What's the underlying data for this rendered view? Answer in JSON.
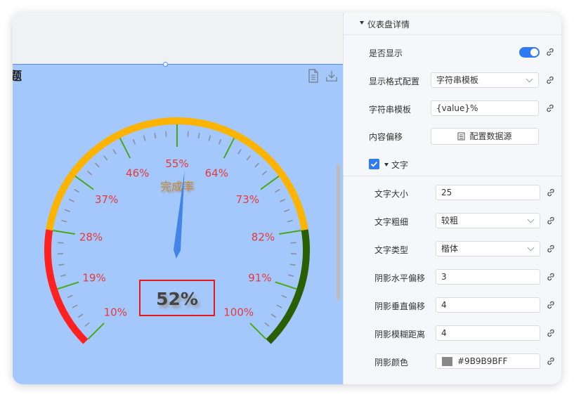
{
  "canvas": {
    "title_fragment": "题",
    "icons": [
      "document-icon",
      "download-icon"
    ]
  },
  "chart_data": {
    "type": "gauge",
    "value": 52,
    "min": 0,
    "max": 100,
    "detail_text": "52%",
    "title_text": "完成率",
    "tick_labels": [
      "10%",
      "19%",
      "28%",
      "37%",
      "46%",
      "55%",
      "64%",
      "73%",
      "82%",
      "91%",
      "100%"
    ],
    "color_bands": [
      {
        "to": 0.2,
        "color": "#ff2020"
      },
      {
        "to": 0.8,
        "color": "#fcb400"
      },
      {
        "to": 1.0,
        "color": "#2b5e00"
      }
    ],
    "pointer_color": "#4285e8",
    "tick_label_color": "#e43a3a",
    "title_color": "#c4873a"
  },
  "panel": {
    "section_title": "仪表盘详情",
    "rows": {
      "show": {
        "label": "是否显示",
        "value": true
      },
      "format": {
        "label": "显示格式配置",
        "value": "字符串模板"
      },
      "template": {
        "label": "字符串模板",
        "value": "{value}%"
      },
      "offset": {
        "label": "内容偏移",
        "button": "配置数据源"
      }
    },
    "text_section": {
      "label": "文字",
      "checked": true
    },
    "text_rows": {
      "size": {
        "label": "文字大小",
        "value": "25"
      },
      "weight": {
        "label": "文字粗细",
        "value": "较粗"
      },
      "family": {
        "label": "文字类型",
        "value": "楷体"
      },
      "shadow_x": {
        "label": "阴影水平偏移",
        "value": "3"
      },
      "shadow_y": {
        "label": "阴影垂直偏移",
        "value": "4"
      },
      "shadow_blur": {
        "label": "阴影模糊距离",
        "value": "4"
      },
      "shadow_color": {
        "label": "阴影颜色",
        "value": "#9B9B9BFF",
        "swatch": "#888888"
      }
    },
    "accent": "#2f7bf5"
  }
}
